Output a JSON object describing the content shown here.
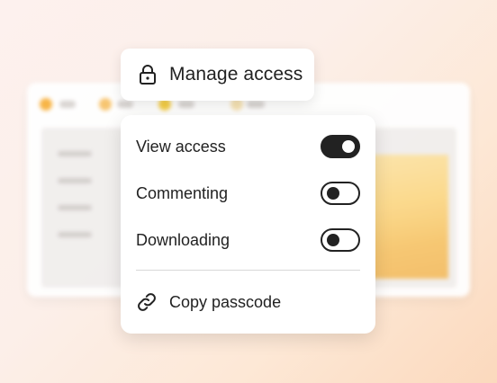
{
  "header": {
    "title": "Manage access",
    "icon": "lock-icon"
  },
  "menu": {
    "items": [
      {
        "label": "View access",
        "enabled": true
      },
      {
        "label": "Commenting",
        "enabled": false
      },
      {
        "label": "Downloading",
        "enabled": false
      }
    ],
    "copy": {
      "label": "Copy passcode",
      "icon": "link-icon"
    }
  },
  "colors": {
    "toggle_on": "#222222",
    "background_warm": "#fbd9bd",
    "window_dots": [
      "#f7b23f",
      "#f7c36a",
      "#f5cd3e",
      "#f6e2b1"
    ]
  }
}
